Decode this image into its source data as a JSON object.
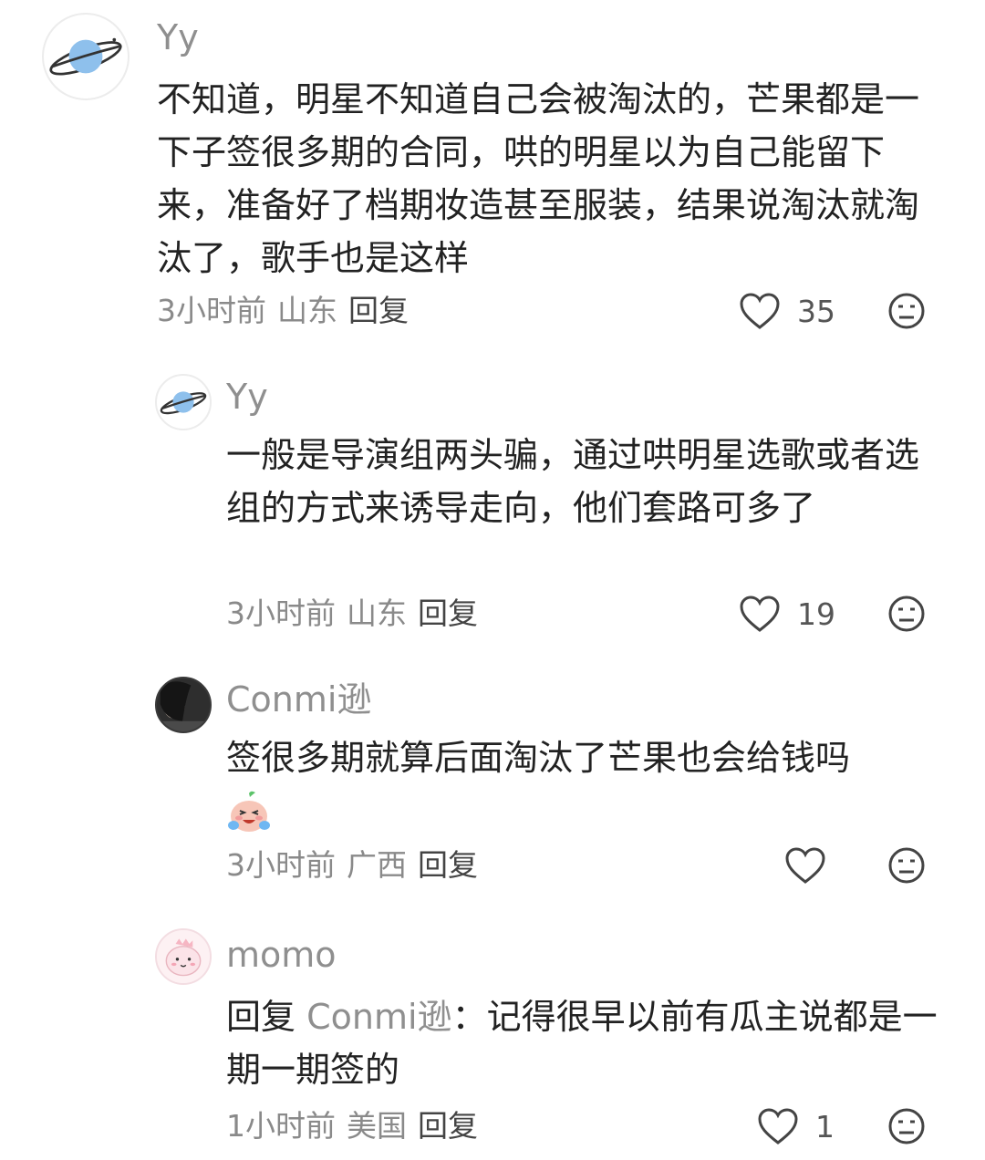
{
  "comments": [
    {
      "username": "Yy",
      "avatar_icon": "planet-icon",
      "text": "不知道，明星不知道自己会被淘汰的，芒果都是一下子签很多期的合同，哄的明星以为自己能留下来，准备好了档期妆造甚至服装，结果说淘汰就淘汰了，歌手也是这样",
      "time": "3小时前",
      "location": "山东",
      "reply_label": "回复",
      "likes": "35"
    },
    {
      "username": "Yy",
      "avatar_icon": "planet-icon",
      "text": "一般是导演组两头骗，通过哄明星选歌或者选组的方式来诱导走向，他们套路可多了",
      "time": "3小时前",
      "location": "山东",
      "reply_label": "回复",
      "likes": "19"
    },
    {
      "username": "Conmi逊",
      "avatar_icon": "user-photo-avatar",
      "text": "签很多期就算后面淘汰了芒果也会给钱吗",
      "emoji": "crying-laughing-emoji",
      "time": "3小时前",
      "location": "广西",
      "reply_label": "回复",
      "likes": ""
    },
    {
      "username": "momo",
      "avatar_icon": "cartoon-dino-avatar",
      "reply_prefix": "回复",
      "mention": "Conmi逊",
      "colon": "：",
      "text": "记得很早以前有瓜主说都是一期一期签的",
      "time": "1小时前",
      "location": "美国",
      "reply_label": "回复",
      "likes": "1"
    }
  ],
  "icons": {
    "like": "heart-outline-icon",
    "dislike": "meh-face-icon"
  },
  "colors": {
    "text": "#222222",
    "meta": "#8a8a8a",
    "username": "#8f8f8f",
    "planet": "#8ec0ec"
  }
}
